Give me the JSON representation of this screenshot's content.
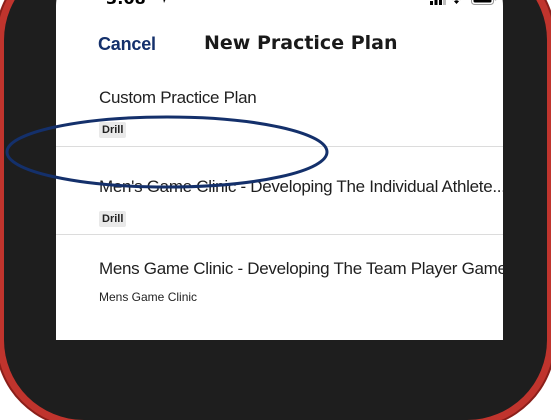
{
  "status_bar": {
    "time": "3:08",
    "icons": [
      "location-arrow-icon",
      "signal-icon",
      "wifi-icon",
      "battery-icon"
    ]
  },
  "nav": {
    "cancel_label": "Cancel",
    "title": "New Practice Plan"
  },
  "plans": [
    {
      "title": "Custom Practice Plan",
      "tag": "Drill"
    },
    {
      "title": "Men's Game Clinic - Developing The Individual Athlete...",
      "tag": "Drill"
    },
    {
      "title": "Mens Game Clinic - Developing The Team Player Game...",
      "subtitle": "Mens Game Clinic"
    }
  ],
  "colors": {
    "accent": "#14306b",
    "phone_frame": "#c0342d",
    "annotation": "#14306b",
    "tag_bg": "#e9e9e9"
  }
}
